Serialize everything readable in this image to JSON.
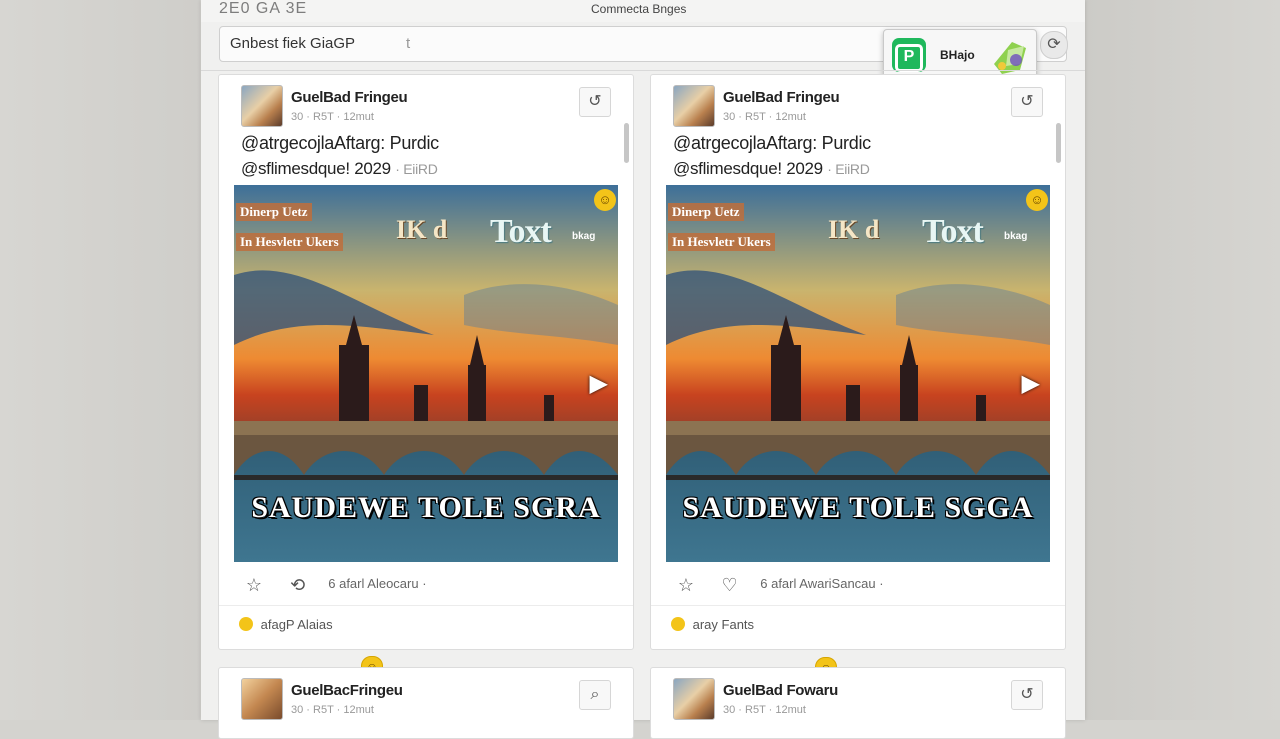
{
  "window": {
    "title_left": "2E0 GA 3E",
    "title": "Commecta Bnges"
  },
  "search": {
    "value": "Gnbest fiek GiaGP",
    "caret": "t"
  },
  "popup": {
    "label": "BHajo"
  },
  "colors": {
    "accent_green": "#1fb85c",
    "emoji_yellow": "#f3c419"
  },
  "posts": [
    {
      "author": "GuelBad Fringeu",
      "meta": "30 · R5T · 12mut",
      "caption_line1": "@atrgecojlaAftarg: Purdic",
      "caption_line2": "@sflimesdque! 2029",
      "caption_muted": "· EiiRD",
      "image": {
        "tag1": "Dinerp Uetz",
        "tag2": "In Hesvletr Ukers",
        "mid_text": "IK d",
        "right_text": "Toxt",
        "right_small": "bkag",
        "banner": "SAUDEWE TOLE SGRA"
      },
      "actions_text": "6 afarl Aleocaru ·",
      "footer": "afagP Alaias"
    },
    {
      "author": "GuelBad Fringeu",
      "meta": "30 · R5T · 12mut",
      "caption_line1": "@atrgecojlaAftarg: Purdic",
      "caption_line2": "@sflimesdque! 2029",
      "caption_muted": "· EiiRD",
      "image": {
        "tag1": "Dinerp Uetz",
        "tag2": "In Hesvletr Ukers",
        "mid_text": "IK d",
        "right_text": "Toxt",
        "right_small": "bkag",
        "banner": "SAUDEWE TOLE SGGA"
      },
      "actions_text": "6 afarl AwariSancau ·",
      "footer": "aray Fants"
    },
    {
      "author": "GuelBacFringeu",
      "meta": "30 · R5T · 12mut"
    },
    {
      "author": "GuelBad Fowaru",
      "meta": "30 · R5T · 12mut"
    }
  ]
}
